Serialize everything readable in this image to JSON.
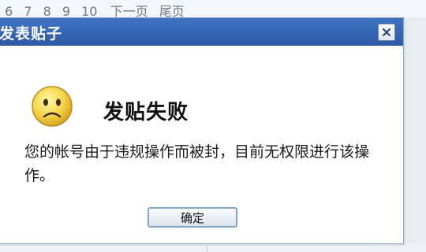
{
  "background": {
    "pagination": {
      "pages": [
        "6",
        "7",
        "8",
        "9",
        "10"
      ],
      "next_label": "下一页",
      "last_label": "尾页"
    }
  },
  "dialog": {
    "title": "发表贴子",
    "close_icon": "close-x",
    "status_icon": "sad-face",
    "heading": "发贴失败",
    "message": "您的帐号由于违规操作而被封，目前无权限进行该操作。",
    "ok_label": "确定"
  },
  "colors": {
    "titlebar": "#3a6bb8",
    "icon_face": "#f6d64a",
    "button_border": "#7fa6c9"
  }
}
